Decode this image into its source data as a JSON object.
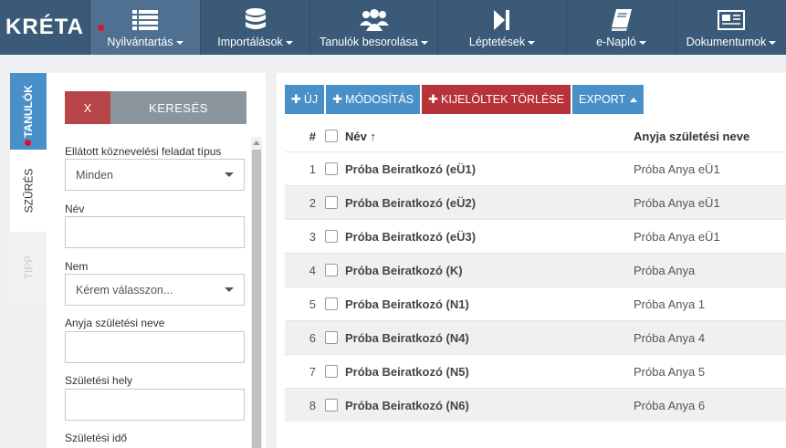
{
  "app": {
    "logo": "KRÉTA"
  },
  "nav": [
    {
      "label": "Nyilvántartás",
      "icon": "list-icon",
      "active": true
    },
    {
      "label": "Importálások",
      "icon": "database-icon",
      "active": false
    },
    {
      "label": "Tanulók besorolása",
      "icon": "users-icon",
      "active": false
    },
    {
      "label": "Léptetések",
      "icon": "step-forward-icon",
      "active": false
    },
    {
      "label": "e-Napló",
      "icon": "book-icon",
      "active": false
    },
    {
      "label": "Dokumentumok",
      "icon": "newspaper-icon",
      "active": false
    }
  ],
  "vtabs": {
    "tanulok": "TANULÓK",
    "szures": "SZŰRÉS",
    "tipp": "TIPP"
  },
  "filter": {
    "clear_label": "X",
    "search_label": "KERESÉS",
    "feladat_label": "Ellátott köznevelési feladat típus",
    "feladat_value": "Minden",
    "nev_label": "Név",
    "nev_value": "",
    "nem_label": "Nem",
    "nem_value": "Kérem válasszon...",
    "anyja_label": "Anyja születési neve",
    "anyja_value": "",
    "hely_label": "Születési hely",
    "hely_value": "",
    "ido_label": "Születési idő"
  },
  "toolbar": {
    "new_label": "ÚJ",
    "modify_label": "MÓDOSÍTÁS",
    "delete_label": "KIJELÖLTEK TÖRLÉSE",
    "export_label": "EXPORT"
  },
  "table": {
    "headers": {
      "num": "#",
      "name": "Név ↑",
      "mother": "Anyja születési neve"
    },
    "rows": [
      {
        "num": "1",
        "name": "Próba Beiratkozó (eÜ1)",
        "mother": "Próba Anya eÜ1"
      },
      {
        "num": "2",
        "name": "Próba Beiratkozó (eÜ2)",
        "mother": "Próba Anya eÜ1"
      },
      {
        "num": "3",
        "name": "Próba Beiratkozó (eÜ3)",
        "mother": "Próba Anya eÜ1"
      },
      {
        "num": "4",
        "name": "Próba Beiratkozó (K)",
        "mother": "Próba Anya"
      },
      {
        "num": "5",
        "name": "Próba Beiratkozó (N1)",
        "mother": "Próba Anya 1"
      },
      {
        "num": "6",
        "name": "Próba Beiratkozó (N4)",
        "mother": "Próba Anya 4"
      },
      {
        "num": "7",
        "name": "Próba Beiratkozó (N5)",
        "mother": "Próba Anya 5"
      },
      {
        "num": "8",
        "name": "Próba Beiratkozó (N6)",
        "mother": "Próba Anya 6"
      }
    ]
  },
  "colors": {
    "nav_bg": "#3a5a78",
    "nav_active": "#4f7090",
    "accent_blue": "#4a90c8",
    "accent_red": "#b8323a",
    "alert_dot": "#e0102a"
  }
}
